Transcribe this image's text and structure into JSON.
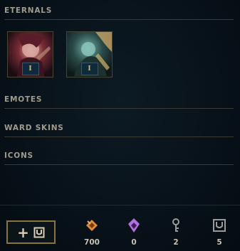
{
  "sections": {
    "eternals": "ETERNALS",
    "emotes": "EMOTES",
    "ward_skins": "WARD SKINS",
    "icons": "ICONS"
  },
  "eternal_tiles": [
    {
      "name": "eternal-tile-1",
      "tier": "I"
    },
    {
      "name": "eternal-tile-2",
      "tier": "I"
    }
  ],
  "footer": {
    "add_button_icon": "chest-plus-icon",
    "currencies": [
      {
        "icon": "blue-essence-icon",
        "color": "#e08a3a",
        "value": "700"
      },
      {
        "icon": "mythic-essence-icon",
        "color": "#b46fe0",
        "value": "0"
      },
      {
        "icon": "key-icon",
        "color": "#9a9a9a",
        "value": "2"
      },
      {
        "icon": "chest-icon",
        "color": "#9a9a9a",
        "value": "5"
      }
    ]
  },
  "colors": {
    "accent_gold": "#8a7341",
    "section_text": "#a09b8c",
    "divider": "#3c3a32"
  }
}
